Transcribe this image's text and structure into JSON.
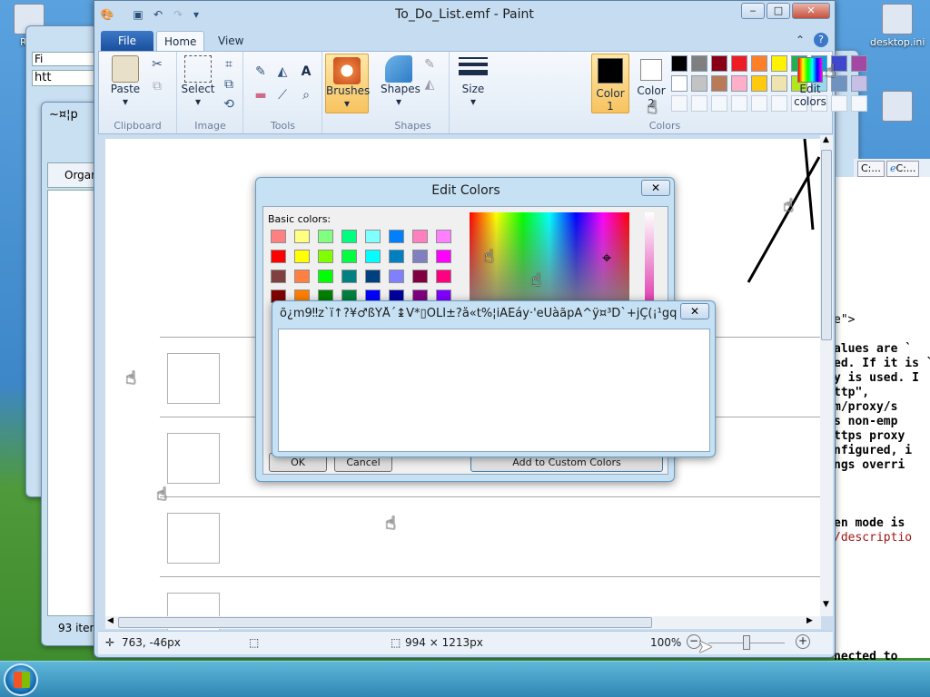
{
  "desktop": {
    "icons": [
      {
        "label": "Rec"
      },
      {
        "label": "desktop.ini"
      }
    ]
  },
  "bg_explorer": {
    "title": "~¤¦p",
    "toolbar_organize": "Organ",
    "status": "93 item",
    "field_hint": "Fi",
    "address": "htt"
  },
  "right_window": {
    "tabs": [
      "C:...",
      "C:..."
    ],
    "lines": [
      {
        "text": "e\">",
        "bold": false,
        "red": false
      },
      {
        "text": "",
        "bold": false,
        "red": false
      },
      {
        "text": "alues are `",
        "bold": true,
        "red": false
      },
      {
        "text": "ed. If it is `",
        "bold": true,
        "red": false
      },
      {
        "text": "y is used. I",
        "bold": true,
        "red": false
      },
      {
        "text": "ttp\",",
        "bold": true,
        "red": false
      },
      {
        "text": "m/proxy/s",
        "bold": true,
        "red": false
      },
      {
        "text": "s non-emp",
        "bold": true,
        "red": false
      },
      {
        "text": "ttps proxy",
        "bold": true,
        "red": false
      },
      {
        "text": "nfigured, i",
        "bold": true,
        "red": false
      },
      {
        "text": "ngs overri",
        "bold": true,
        "red": false
      },
      {
        "text": "",
        "bold": false,
        "red": false
      },
      {
        "text": "",
        "bold": false,
        "red": false
      },
      {
        "text": "",
        "bold": false,
        "red": false
      },
      {
        "text": "en mode is",
        "bold": true,
        "red": false
      },
      {
        "text": "/descriptio",
        "bold": false,
        "red": true
      }
    ],
    "bottom_line": "nected to dire"
  },
  "paint": {
    "title": "To_Do_List.emf - Paint",
    "tabs": {
      "file": "File",
      "home": "Home",
      "view": "View"
    },
    "clipboard": {
      "paste": "Paste",
      "label": "Clipboard"
    },
    "image": {
      "select": "Select",
      "label": "Image"
    },
    "tools": {
      "label": "Tools"
    },
    "brushes": {
      "label": "Brushes"
    },
    "shapes": {
      "button": "Shapes",
      "label": "Shapes"
    },
    "size": {
      "label": "Size"
    },
    "color1": {
      "label": "Color",
      "num": "1"
    },
    "color2": {
      "label": "Color",
      "num": "2"
    },
    "colors_group": {
      "label": "Colors"
    },
    "edit_colors": {
      "label1": "Edit",
      "label2": "colors"
    },
    "palette_row1": [
      "#000000",
      "#7f7f7f",
      "#880015",
      "#ed1c24",
      "#ff7f27",
      "#fff200",
      "#22b14c",
      "#00a2e8",
      "#3f48cc",
      "#a349a4"
    ],
    "palette_row2": [
      "#ffffff",
      "#c3c3c3",
      "#b97a57",
      "#ffaec9",
      "#ffc90e",
      "#efe4b0",
      "#b5e61d",
      "#99d9ea",
      "#7092be",
      "#c8bfe7"
    ],
    "status": {
      "cursor_pos": "763, -46px",
      "image_size": "994 × 1213px",
      "zoom": "100%"
    }
  },
  "edit_colors_dialog": {
    "title": "Edit Colors",
    "close": "✕",
    "basic_colors_label": "Basic colors:",
    "basic_colors": [
      [
        "#ff8080",
        "#ffff80",
        "#80ff80",
        "#00ff80",
        "#80ffff",
        "#0080ff",
        "#ff80c0",
        "#ff80ff"
      ],
      [
        "#ff0000",
        "#ffff00",
        "#80ff00",
        "#00ff40",
        "#00ffff",
        "#0080c0",
        "#8080c0",
        "#ff00ff"
      ],
      [
        "#804040",
        "#ff8040",
        "#00ff00",
        "#008080",
        "#004080",
        "#8080ff",
        "#800040",
        "#ff0080"
      ],
      [
        "#800000",
        "#ff8000",
        "#008000",
        "#008040",
        "#0000ff",
        "#0000a0",
        "#800080",
        "#8000ff"
      ]
    ],
    "ok": "OK",
    "cancel": "Cancel",
    "add_custom": "Add to Custom Colors"
  },
  "garbled_dialog": {
    "title": "õ¿m9‼z`ï↑?¥♂ßÝÅ´↨V*▯ÕLÍ±?å«t%¦iÂEáy·'eÚàãpA^ÿ¤³D`+jÇ(¡¹gq↕...",
    "close": "✕"
  }
}
